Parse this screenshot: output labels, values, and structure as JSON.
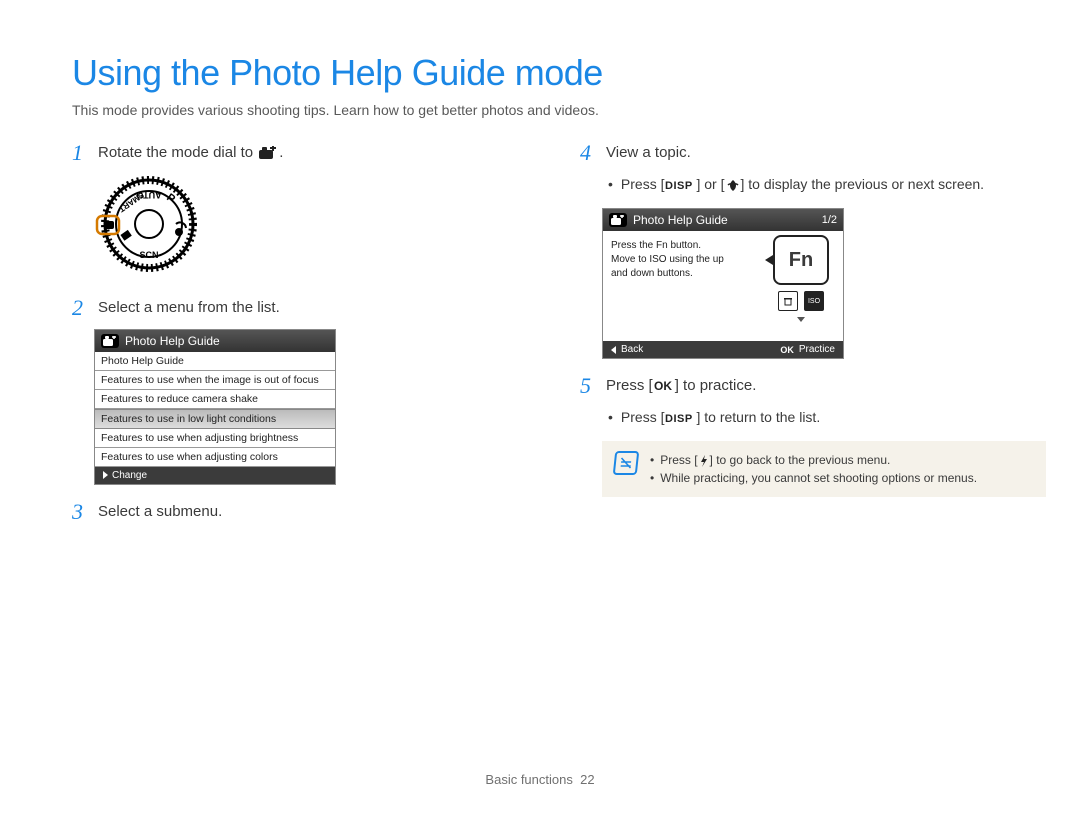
{
  "title": "Using the Photo Help Guide mode",
  "subtitle": "This mode provides various shooting tips. Learn how to get better photos and videos.",
  "steps": {
    "s1": {
      "num": "1",
      "text_a": "Rotate the mode dial to ",
      "text_b": "."
    },
    "s2": {
      "num": "2",
      "text": "Select a menu from the list."
    },
    "s3": {
      "num": "3",
      "text": "Select a submenu."
    },
    "s4": {
      "num": "4",
      "text": "View a topic."
    },
    "s4b_a": "Press [",
    "s4b_b": "] or [",
    "s4b_c": "] to display the previous or next screen.",
    "s5": {
      "num": "5",
      "text_a": "Press [",
      "text_b": "] to practice."
    },
    "s5b_a": "Press [",
    "s5b_b": "] to return to the list."
  },
  "lcd1": {
    "header": "Photo Help Guide",
    "items": [
      "Photo Help Guide",
      "Features to use when the image is out of focus",
      "Features to reduce camera shake",
      "Features to use in low light conditions",
      "Features to use when adjusting brightness",
      "Features to use when adjusting colors"
    ],
    "selected_index": 3,
    "footer": "Change"
  },
  "lcd2": {
    "header": "Photo Help Guide",
    "page": "1/2",
    "body_line1": "Press the Fn button.",
    "body_line2": "Move to ISO using the up",
    "body_line3": "and down buttons.",
    "fn": "Fn",
    "back": "Back",
    "practice": "Practice"
  },
  "note": {
    "n1_a": "Press [",
    "n1_b": "] to go back to the previous menu.",
    "n2": "While practicing, you cannot set shooting options or menus."
  },
  "footer": {
    "section": "Basic functions",
    "page": "22"
  },
  "glyphs": {
    "disp": "DISP",
    "ok": "OK"
  }
}
